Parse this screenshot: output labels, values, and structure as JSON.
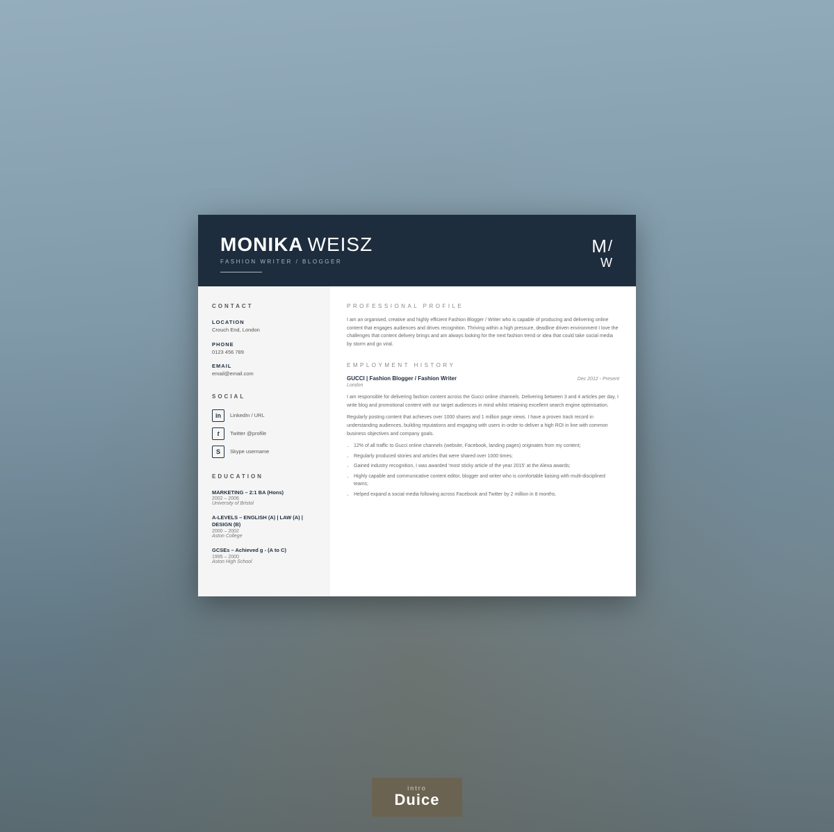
{
  "header": {
    "first_name": "MONIKA",
    "last_name": "WEISZ",
    "title": "FASHION WRITER / BLOGGER",
    "monogram_m": "M",
    "monogram_slash": "/",
    "monogram_w": "W"
  },
  "sidebar": {
    "contact_section_title": "CONTACT",
    "location_label": "LOCATION",
    "location_value": "Crouch End, London",
    "phone_label": "PHONE",
    "phone_value": "0123 456 789",
    "email_label": "EMAIL",
    "email_value": "email@email.com",
    "social_section_title": "SOCIAL",
    "social_items": [
      {
        "icon": "in",
        "label": "LinkedIn / URL"
      },
      {
        "icon": "t",
        "label": "Twitter @profile"
      },
      {
        "icon": "s",
        "label": "Skype username"
      }
    ],
    "education_section_title": "EDUCATION",
    "education_items": [
      {
        "degree": "MARKETING – 2:1 BA (Hons)",
        "years": "2002 – 2006",
        "school": "University of Bristol"
      },
      {
        "degree": "A-LEVELS – ENGLISH (A) | LAW (A) | DESIGN (B)",
        "years": "2000 – 2002",
        "school": "Aston College"
      },
      {
        "degree": "GCSEs – Achieved g - (A to C)",
        "years": "1995 – 2000",
        "school": "Aston High School"
      }
    ]
  },
  "main": {
    "profile_section_title": "PROFESSIONAL PROFILE",
    "profile_text": "I am an organised, creative and highly efficient Fashion Blogger / Writer who is capable of producing and delivering online content that engages audiences and drives recognition. Thriving within a high pressure, deadline driven environment I love the challenges that content delivery brings and am always looking for the next fashion trend or idea that could take social media by storm and go viral.",
    "employment_section_title": "EMPLOYMENT HISTORY",
    "jobs": [
      {
        "title": "GUCCI | Fashion Blogger / Fashion Writer",
        "dates": "Dec 2012 - Present",
        "location": "London",
        "desc1": "I am responsible for delivering fashion content across the Gucci online channels. Delivering between 3 and 4 articles per day, I write blog and promotional content with our target audiences in mind whilst retaining excellent search engine optimisation.",
        "desc2": "Regularly posting content that achieves over 1000 shares and 1 million page views. I have a proven track record in understanding audiences, building reputations and engaging with users in order to deliver a high ROI in line with common business objectives and company goals.",
        "bullets": [
          "12% of all traffic to Gucci online channels (website, Facebook, landing pages) originates from my content;",
          "Regularly produced stories and articles that were shared over 1000 times;",
          "Gained industry recognition, I was awarded 'most sticky article of the year 2015' at the Alexa awards;",
          "Highly capable and communicative content editor, blogger and writer  who is comfortable liaising with multi-disciplined teams;",
          "Helped expand a social media following across Facebook and Twitter by 2 million in 8 months."
        ]
      }
    ]
  },
  "branding": {
    "intro": "intro",
    "name": "Duice"
  }
}
